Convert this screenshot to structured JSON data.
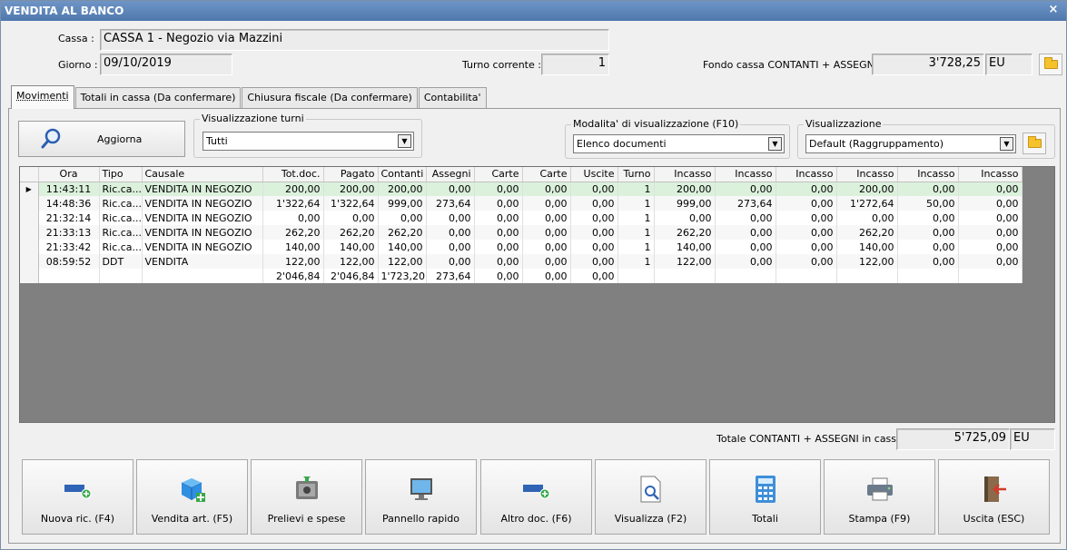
{
  "window": {
    "title": "VENDITA AL BANCO",
    "close_glyph": "×"
  },
  "header": {
    "cassa_label": "Cassa :",
    "cassa_value": "CASSA 1 - Negozio via Mazzini",
    "giorno_label": "Giorno :",
    "giorno_value": "09/10/2019",
    "turno_label": "Turno corrente :",
    "turno_value": "1",
    "fondo_label": "Fondo cassa CONTANTI + ASSEGNI :",
    "fondo_value": "3'728,25",
    "fondo_currency": "EU"
  },
  "tabs": [
    {
      "label": "Movimenti",
      "active": true
    },
    {
      "label": "Totali in cassa (Da confermare)",
      "active": false
    },
    {
      "label": "Chiusura fiscale (Da confermare)",
      "active": false
    },
    {
      "label": "Contabilita'",
      "active": false
    }
  ],
  "toolbar": {
    "refresh_label": "Aggiorna",
    "turni_group_label": "Visualizzazione turni",
    "turni_value": "Tutti",
    "modalita_group_label": "Modalita' di visualizzazione (F10)",
    "modalita_value": "Elenco documenti",
    "vis_group_label": "Visualizzazione",
    "vis_value": "Default (Raggruppamento)"
  },
  "table": {
    "columns": [
      "Ora",
      "Tipo",
      "Causale",
      "Tot.doc.",
      "Pagato",
      "Contanti",
      "Assegni",
      "Carte",
      "Carte",
      "Uscite",
      "Turno",
      "Incasso",
      "Incasso",
      "Incasso",
      "Incasso",
      "Incasso",
      "Incasso"
    ],
    "rows": [
      [
        "11:43:11",
        "Ric.ca...",
        "VENDITA IN NEGOZIO",
        "200,00",
        "200,00",
        "200,00",
        "0,00",
        "0,00",
        "0,00",
        "0,00",
        "1",
        "200,00",
        "0,00",
        "0,00",
        "200,00",
        "0,00",
        "0,00"
      ],
      [
        "14:48:36",
        "Ric.ca...",
        "VENDITA IN NEGOZIO",
        "1'322,64",
        "1'322,64",
        "999,00",
        "273,64",
        "0,00",
        "0,00",
        "0,00",
        "1",
        "999,00",
        "273,64",
        "0,00",
        "1'272,64",
        "50,00",
        "0,00"
      ],
      [
        "21:32:14",
        "Ric.ca...",
        "VENDITA IN NEGOZIO",
        "0,00",
        "0,00",
        "0,00",
        "0,00",
        "0,00",
        "0,00",
        "0,00",
        "1",
        "0,00",
        "0,00",
        "0,00",
        "0,00",
        "0,00",
        "0,00"
      ],
      [
        "21:33:13",
        "Ric.ca...",
        "VENDITA IN NEGOZIO",
        "262,20",
        "262,20",
        "262,20",
        "0,00",
        "0,00",
        "0,00",
        "0,00",
        "1",
        "262,20",
        "0,00",
        "0,00",
        "262,20",
        "0,00",
        "0,00"
      ],
      [
        "21:33:42",
        "Ric.ca...",
        "VENDITA IN NEGOZIO",
        "140,00",
        "140,00",
        "140,00",
        "0,00",
        "0,00",
        "0,00",
        "0,00",
        "1",
        "140,00",
        "0,00",
        "0,00",
        "140,00",
        "0,00",
        "0,00"
      ],
      [
        "08:59:52",
        "DDT",
        "VENDITA",
        "122,00",
        "122,00",
        "122,00",
        "0,00",
        "0,00",
        "0,00",
        "0,00",
        "1",
        "122,00",
        "0,00",
        "0,00",
        "122,00",
        "0,00",
        "0,00"
      ]
    ],
    "totals": [
      "",
      "",
      "",
      "2'046,84",
      "2'046,84",
      "1'723,20",
      "273,64",
      "0,00",
      "0,00",
      "0,00",
      "",
      "",
      "",
      "",
      "",
      "",
      ""
    ],
    "row_marker": "▶"
  },
  "footer": {
    "totale_label": "Totale CONTANTI + ASSEGNI in cassa :",
    "totale_value": "5'725,09",
    "totale_currency": "EU"
  },
  "actions": [
    {
      "label": "Nuova ric. (F4)",
      "icon": "new-receipt-icon"
    },
    {
      "label": "Vendita art. (F5)",
      "icon": "cube-add-icon"
    },
    {
      "label": "Prelievi e spese",
      "icon": "safe-icon"
    },
    {
      "label": "Pannello rapido",
      "icon": "monitor-icon"
    },
    {
      "label": "Altro doc. (F6)",
      "icon": "new-document-icon"
    },
    {
      "label": "Visualizza (F2)",
      "icon": "view-document-icon"
    },
    {
      "label": "Totali",
      "icon": "calculator-icon"
    },
    {
      "label": "Stampa (F9)",
      "icon": "printer-icon"
    },
    {
      "label": "Uscita (ESC)",
      "icon": "exit-door-icon"
    }
  ]
}
